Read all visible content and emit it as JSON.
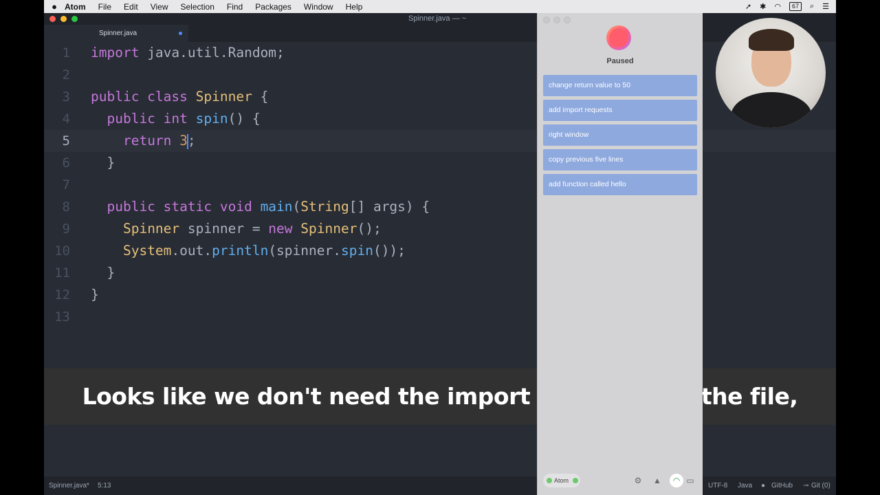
{
  "menubar": {
    "apple": "",
    "items": [
      "Atom",
      "File",
      "Edit",
      "View",
      "Selection",
      "Find",
      "Packages",
      "Window",
      "Help"
    ],
    "battery": "67"
  },
  "window": {
    "title": "Spinner.java — ~"
  },
  "tab": {
    "label": "Spinner.java"
  },
  "editor": {
    "line_numbers": [
      "1",
      "2",
      "3",
      "4",
      "5",
      "6",
      "7",
      "8",
      "9",
      "10",
      "11",
      "12",
      "13"
    ],
    "lines": [
      [
        {
          "t": "import",
          "c": "kw"
        },
        {
          "t": " java.util.Random;"
        }
      ],
      [],
      [
        {
          "t": "public class",
          "c": "kw"
        },
        {
          "t": " "
        },
        {
          "t": "Spinner",
          "c": "cls"
        },
        {
          "t": " {"
        }
      ],
      [
        {
          "t": "  "
        },
        {
          "t": "public int",
          "c": "kw"
        },
        {
          "t": " "
        },
        {
          "t": "spin",
          "c": "fn"
        },
        {
          "t": "() {"
        }
      ],
      [
        {
          "t": "    "
        },
        {
          "t": "return",
          "c": "kw"
        },
        {
          "t": " "
        },
        {
          "t": "3",
          "c": "num"
        },
        {
          "cursor": true
        },
        {
          "t": ";"
        }
      ],
      [
        {
          "t": "  }"
        }
      ],
      [],
      [
        {
          "t": "  "
        },
        {
          "t": "public static void",
          "c": "kw"
        },
        {
          "t": " "
        },
        {
          "t": "main",
          "c": "fn"
        },
        {
          "t": "("
        },
        {
          "t": "String",
          "c": "cls"
        },
        {
          "t": "[] args) {"
        }
      ],
      [
        {
          "t": "    "
        },
        {
          "t": "Spinner",
          "c": "cls"
        },
        {
          "t": " spinner = "
        },
        {
          "t": "new",
          "c": "kw"
        },
        {
          "t": " "
        },
        {
          "t": "Spinner",
          "c": "cls"
        },
        {
          "t": "();"
        }
      ],
      [
        {
          "t": "    "
        },
        {
          "t": "System",
          "c": "cls"
        },
        {
          "t": ".out."
        },
        {
          "t": "println",
          "c": "fn"
        },
        {
          "t": "(spinner."
        },
        {
          "t": "spin",
          "c": "fn"
        },
        {
          "t": "());"
        }
      ],
      [
        {
          "t": "  }"
        }
      ],
      [
        {
          "t": "}"
        }
      ],
      []
    ]
  },
  "statusbar": {
    "file": "Spinner.java*",
    "position": "5:13",
    "encoding": "UTF-8",
    "grammar": "Java",
    "github": "GitHub",
    "git": "Git (0)"
  },
  "voice_panel": {
    "status": "Paused",
    "suggestions": [
      "change return value to 50",
      "add import requests",
      "right window",
      "copy previous five lines",
      "add function called hello"
    ],
    "app_label": "Atom"
  },
  "caption": "Looks like we don't need the import at the top of the file,",
  "colors": {
    "keyword": "#c678dd",
    "class": "#e5c07b",
    "function": "#61afef",
    "number": "#d19a66",
    "suggestion_bg": "#8ea9de"
  }
}
